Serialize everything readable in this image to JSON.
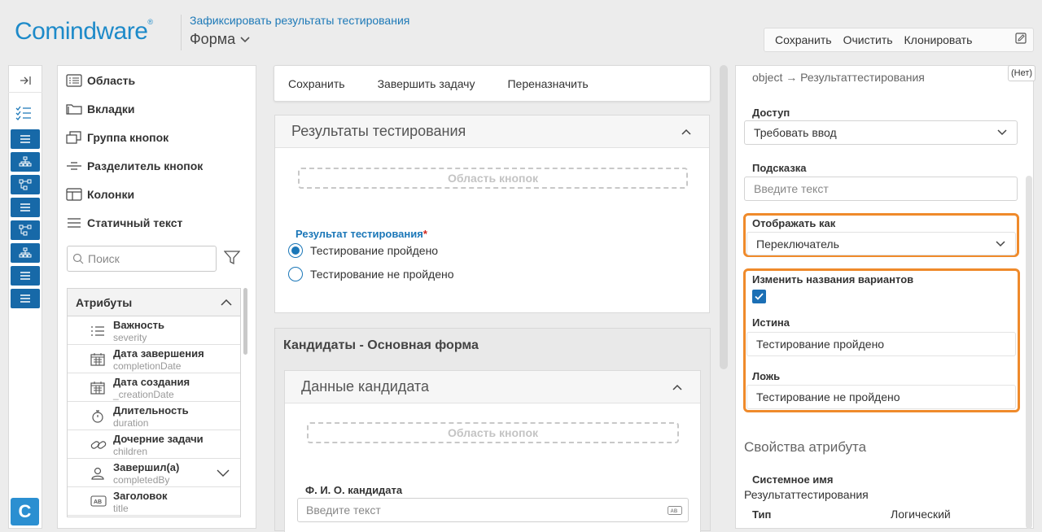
{
  "header": {
    "logo": "Comindware",
    "logo_mark": "®",
    "breadcrumb_link": "Зафиксировать результаты тестирования",
    "title": "Форма",
    "toolbar": {
      "save": "Сохранить",
      "clear": "Очистить",
      "clone": "Клонировать"
    }
  },
  "nav": {
    "app_letter": "C"
  },
  "components": {
    "items": [
      "Область",
      "Вкладки",
      "Группа кнопок",
      "Разделитель кнопок",
      "Колонки",
      "Статичный текст"
    ],
    "search_placeholder": "Поиск",
    "attributes_title": "Атрибуты",
    "attributes": [
      {
        "name": "Важность",
        "system": "severity"
      },
      {
        "name": "Дата завершения",
        "system": "completionDate"
      },
      {
        "name": "Дата создания",
        "system": "_creationDate"
      },
      {
        "name": "Длительность",
        "system": "duration"
      },
      {
        "name": "Дочерние задачи",
        "system": "children"
      },
      {
        "name": "Завершил(а)",
        "system": "completedBy"
      },
      {
        "name": "Заголовок",
        "system": "title"
      }
    ]
  },
  "center": {
    "toolbar": {
      "save": "Сохранить",
      "complete": "Завершить задачу",
      "reassign": "Переназначить"
    },
    "card1": {
      "title": "Результаты тестирования",
      "button_area": "Область кнопок",
      "field_label": "Результат тестирования",
      "required_mark": "*",
      "options": [
        "Тестирование пройдено",
        "Тестирование не пройдено"
      ]
    },
    "section2_title": "Кандидаты - Основная форма",
    "card2": {
      "title": "Данные кандидата",
      "button_area": "Область кнопок",
      "field_label": "Ф. И. О. кандидата",
      "field_placeholder": "Введите текст"
    }
  },
  "right": {
    "badge": "(Нет)",
    "path": "object → Результаттестирования",
    "access_label": "Доступ",
    "access_value": "Требовать ввод",
    "hint_label": "Подсказка",
    "hint_placeholder": "Введите текст",
    "display_label": "Отображать как",
    "display_value": "Переключатель",
    "rename_label": "Изменить названия вариантов",
    "true_label": "Истина",
    "true_value": "Тестирование пройдено",
    "false_label": "Ложь",
    "false_value": "Тестирование не пройдено",
    "props_title": "Свойства атрибута",
    "sysname_label": "Системное имя",
    "sysname_value": "Результаттестирования",
    "type_label": "Тип",
    "type_value": "Логический"
  },
  "colors": {
    "accent": "#1b6fb5",
    "highlight": "#ef8a2b",
    "required": "#d0281f"
  }
}
